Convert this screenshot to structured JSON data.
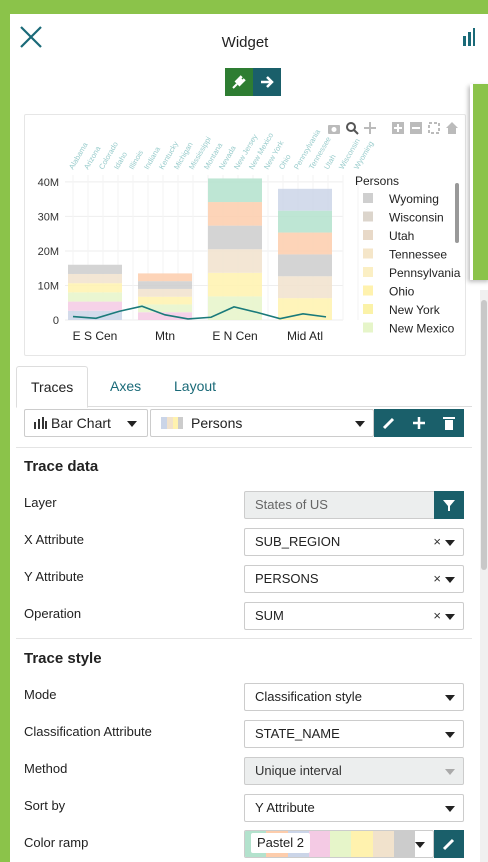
{
  "header": {
    "title": "Widget"
  },
  "icons": {
    "close": "close-icon",
    "chart": "bar-chart-icon",
    "plug": "plug-icon",
    "arrow": "arrow-right-icon"
  },
  "chart_data": {
    "type": "bar",
    "categories": [
      "E S Cen",
      "Mtn",
      "E N Cen",
      "Mid Atl"
    ],
    "top_labels": [
      "Alabama",
      "Arizona",
      "Colorado",
      "Idaho",
      "Illinois",
      "Indiana",
      "Kentucky",
      "Michigan",
      "Mississippi",
      "Montana",
      "Nevada",
      "New Jersey",
      "New Mexico",
      "New York",
      "Ohio",
      "Pennsylvania",
      "Tennessee",
      "Utah",
      "Wisconsin",
      "Wyoming"
    ],
    "yticks": [
      "0",
      "10M",
      "20M",
      "30M",
      "40M"
    ],
    "ylim": [
      0,
      42000000
    ],
    "totals": [
      16000000,
      13500000,
      41000000,
      38000000
    ],
    "line_values": [
      1000000,
      500000,
      2500000,
      4000000,
      1500000,
      300000,
      800000,
      3800000,
      2200000,
      400000,
      1800000,
      900000
    ],
    "legend_title": "Persons",
    "legend": [
      {
        "name": "Wyoming",
        "color": "#cfcfcf"
      },
      {
        "name": "Wisconsin",
        "color": "#dcd5cc"
      },
      {
        "name": "Utah",
        "color": "#e8d9c8"
      },
      {
        "name": "Tennessee",
        "color": "#f5e6c9"
      },
      {
        "name": "Pennsylvania",
        "color": "#fbefc4"
      },
      {
        "name": "Ohio",
        "color": "#fff2ae"
      },
      {
        "name": "New York",
        "color": "#fbf2a8"
      },
      {
        "name": "New Mexico",
        "color": "#e6f5c9"
      }
    ]
  },
  "tabs": [
    {
      "label": "Traces"
    },
    {
      "label": "Axes"
    },
    {
      "label": "Layout"
    }
  ],
  "trace_bar": {
    "type_label": "Bar Chart",
    "trace_label": "Persons"
  },
  "trace_data": {
    "title": "Trace data",
    "layer_label": "Layer",
    "layer_value": "States of US",
    "x_label": "X Attribute",
    "x_value": "SUB_REGION",
    "y_label": "Y Attribute",
    "y_value": "PERSONS",
    "op_label": "Operation",
    "op_value": "SUM"
  },
  "trace_style": {
    "title": "Trace style",
    "mode_label": "Mode",
    "mode_value": "Classification style",
    "class_label": "Classification Attribute",
    "class_value": "STATE_NAME",
    "method_label": "Method",
    "method_value": "Unique interval",
    "sort_label": "Sort by",
    "sort_value": "Y Attribute",
    "ramp_label": "Color ramp",
    "ramp_value": "Pastel 2",
    "ramp_colors": [
      "#b3e2cd",
      "#fdcdac",
      "#cbd5e8",
      "#f4cae4",
      "#e6f5c9",
      "#fff2ae",
      "#f1e2cc",
      "#cccccc"
    ]
  },
  "colors": {
    "accent": "#1a5f6a",
    "green": "#8bc34a",
    "dark_green": "#2e7d32"
  }
}
